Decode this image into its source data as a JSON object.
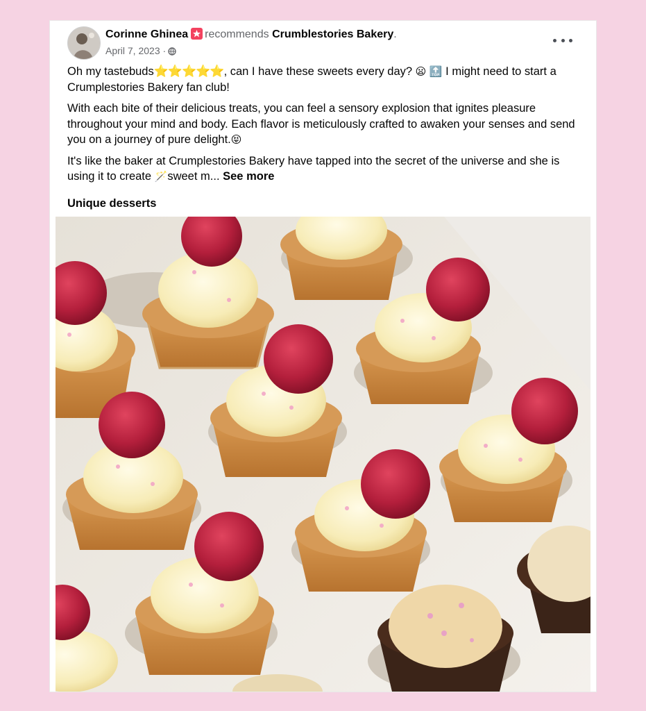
{
  "post": {
    "author_name": "Corinne Ghinea",
    "action_text": "recommends",
    "page_name": "Crumblestories Bakery",
    "page_suffix": ".",
    "date": "April 7, 2023",
    "date_separator": "·",
    "privacy_icon": "globe-icon",
    "paragraph1_prefix": "Oh my tastebuds",
    "paragraph1_stars": "⭐⭐⭐⭐⭐",
    "paragraph1_mid": ", can I have these sweets every day? ",
    "paragraph1_emoji1": "😦",
    "paragraph1_emoji2": "🔝",
    "paragraph1_suffix": "I might need to start a Crumplestories Bakery fan club!",
    "paragraph2": " With each bite of their delicious treats, you can feel a sensory explosion that ignites pleasure throughout your mind and body. Each flavor is meticulously crafted to awaken your senses and send you on a journey of pure delight.",
    "paragraph2_emoji": "😝",
    "paragraph3_text": "It's like the baker at Crumplestories Bakery have tapped into the secret of the universe and she is using it to create ",
    "paragraph3_emoji": "🪄",
    "paragraph3_tail": "sweet m...",
    "see_more": "See more",
    "section_title": "Unique desserts",
    "photo_description_icon": "cupcakes-photo"
  },
  "colors": {
    "background": "#f6d3e3",
    "recommend_badge": "#f3425f",
    "muted_text": "#65676b"
  }
}
